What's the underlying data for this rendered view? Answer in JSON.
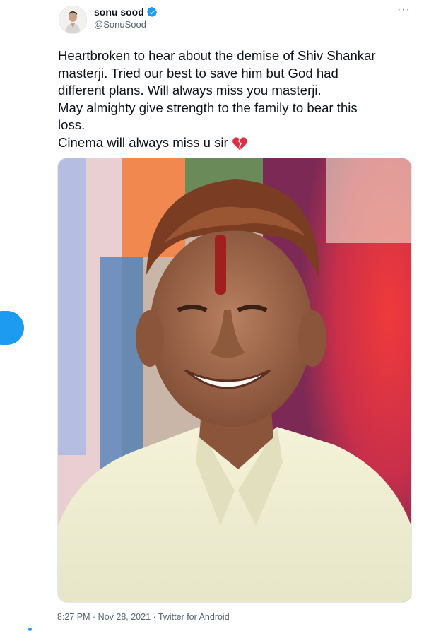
{
  "user": {
    "display_name": "sonu sood",
    "handle": "@SonuSood",
    "verified_icon": "verified-badge-icon",
    "avatar_icon": "profile-avatar"
  },
  "more_label": "···",
  "tweet": {
    "lines": [
      "Heartbroken to hear about the demise of Shiv Shankar",
      "masterji. Tried our best to save him but God had",
      "different plans. Will always miss you masterji.",
      "May almighty give strength to the family to bear this",
      "loss.",
      "Cinema will always miss u sir"
    ],
    "emoji_icon": "broken-heart-icon"
  },
  "photo_icon": "portrait-photo",
  "meta": {
    "time": "8:27 PM",
    "sep1": " · ",
    "date": "Nov 28, 2021",
    "sep2": " · ",
    "source": "Twitter for Android"
  },
  "colors": {
    "accent": "#1d9bf0",
    "text": "#0f1419",
    "muted": "#536471"
  }
}
